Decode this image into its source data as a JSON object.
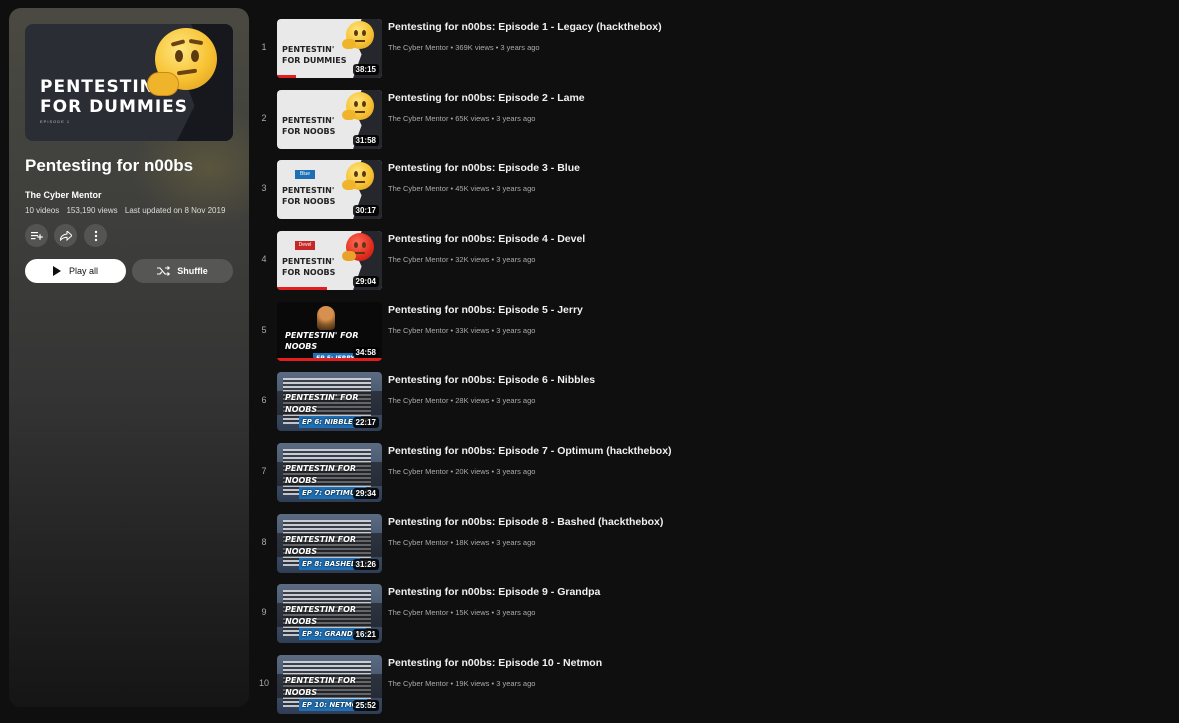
{
  "playlist": {
    "cover": {
      "line1": "PENTESTIN'",
      "line2": "FOR DUMMIES",
      "episode": "EPISODE 1"
    },
    "title": "Pentesting for n00bs",
    "owner": "The Cyber Mentor",
    "video_count": "10 videos",
    "views": "153,190 views",
    "updated": "Last updated on 8 Nov 2019",
    "play_all_label": "Play all",
    "shuffle_label": "Shuffle",
    "icons": {
      "save": "add-to-queue-icon",
      "share": "share-icon",
      "more": "more-vert-icon",
      "play": "play-icon",
      "shuffle": "shuffle-icon"
    }
  },
  "videos": [
    {
      "index": "1",
      "title": "Pentesting for n00bs: Episode 1 - Legacy (hackthebox)",
      "channel": "The Cyber Mentor",
      "views": "369K views",
      "age": "3 years ago",
      "duration": "38:15",
      "thumb_line1": "PENTESTIN'",
      "thumb_line2": "FOR DUMMIES",
      "progress": 0.18
    },
    {
      "index": "2",
      "title": "Pentesting for n00bs: Episode 2 - Lame",
      "channel": "The Cyber Mentor",
      "views": "65K views",
      "age": "3 years ago",
      "duration": "31:58",
      "thumb_line1": "PENTESTIN'",
      "thumb_line2": "FOR NOOBS"
    },
    {
      "index": "3",
      "title": "Pentesting for n00bs: Episode 3 - Blue",
      "channel": "The Cyber Mentor",
      "views": "45K views",
      "age": "3 years ago",
      "duration": "30:17",
      "thumb_line1": "PENTESTIN'",
      "thumb_line2": "FOR NOOBS",
      "tag": "Blue",
      "tag_color": "#1e6fb4"
    },
    {
      "index": "4",
      "title": "Pentesting for n00bs: Episode 4 - Devel",
      "channel": "The Cyber Mentor",
      "views": "32K views",
      "age": "3 years ago",
      "duration": "29:04",
      "thumb_line1": "PENTESTIN'",
      "thumb_line2": "FOR NOOBS",
      "tag": "Devel",
      "tag_color": "#c62828",
      "progress": 0.48
    },
    {
      "index": "5",
      "title": "Pentesting for n00bs: Episode 5 - Jerry",
      "channel": "The Cyber Mentor",
      "views": "33K views",
      "age": "3 years ago",
      "duration": "34:58",
      "thumb_line1": "PENTESTIN' FOR NOOBS",
      "thumb_line2": "EP 5: JERRY",
      "progress": 1.0
    },
    {
      "index": "6",
      "title": "Pentesting for n00bs: Episode 6 - Nibbles",
      "channel": "The Cyber Mentor",
      "views": "28K views",
      "age": "3 years ago",
      "duration": "22:17",
      "thumb_line1": "PENTESTIN' FOR NOOBS",
      "thumb_line2": "EP 6: NIBBLES"
    },
    {
      "index": "7",
      "title": "Pentesting for n00bs: Episode 7 - Optimum (hackthebox)",
      "channel": "The Cyber Mentor",
      "views": "20K views",
      "age": "3 years ago",
      "duration": "29:34",
      "thumb_line1": "PENTESTIN FOR NOOBS",
      "thumb_line2": "EP 7: OPTIMUM"
    },
    {
      "index": "8",
      "title": "Pentesting for n00bs: Episode 8 - Bashed (hackthebox)",
      "channel": "The Cyber Mentor",
      "views": "18K views",
      "age": "3 years ago",
      "duration": "31:26",
      "thumb_line1": "PENTESTIN FOR NOOBS",
      "thumb_line2": "EP 8: BASHED"
    },
    {
      "index": "9",
      "title": "Pentesting for n00bs: Episode 9 - Grandpa",
      "channel": "The Cyber Mentor",
      "views": "15K views",
      "age": "3 years ago",
      "duration": "16:21",
      "thumb_line1": "PENTESTIN FOR NOOBS",
      "thumb_line2": "EP 9: GRANDPA"
    },
    {
      "index": "10",
      "title": "Pentesting for n00bs: Episode 10 - Netmon",
      "channel": "The Cyber Mentor",
      "views": "19K views",
      "age": "3 years ago",
      "duration": "25:52",
      "thumb_line1": "PENTESTIN FOR NOOBS",
      "thumb_line2": "EP 10: NETMON"
    }
  ],
  "colors": {
    "background": "#0f0f0f",
    "progress": "#e41e1e",
    "episode_badge": "#1e6fb4"
  }
}
